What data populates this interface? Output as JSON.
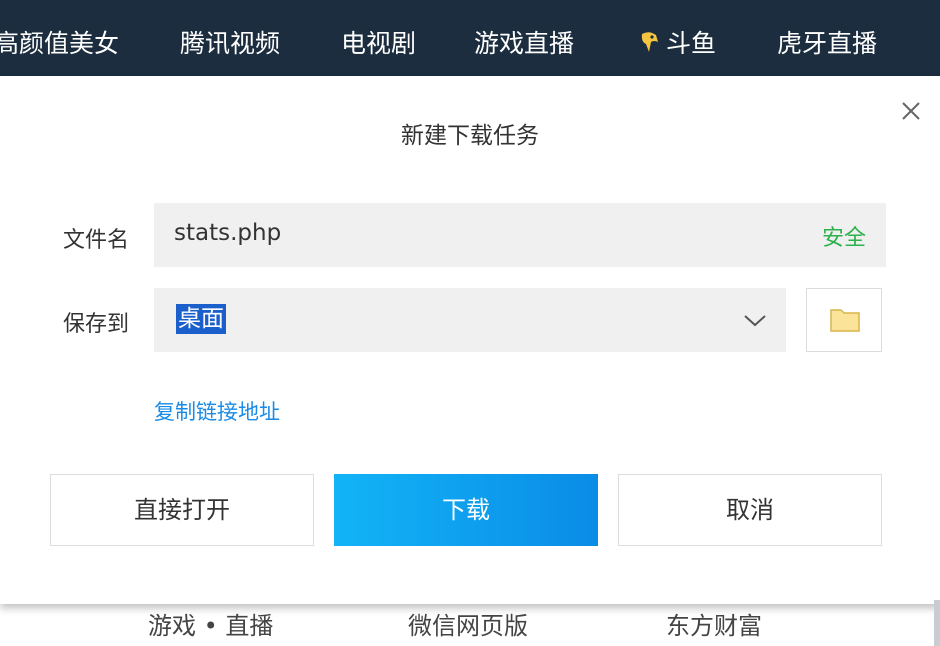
{
  "topnav": {
    "items": [
      {
        "label": "高颜值美女"
      },
      {
        "label": "腾讯视频"
      },
      {
        "label": "电视剧"
      },
      {
        "label": "游戏直播"
      },
      {
        "label": "斗鱼",
        "icon": "douyu-fish-icon"
      },
      {
        "label": "虎牙直播"
      }
    ]
  },
  "dialog": {
    "title": "新建下载任务",
    "close_icon": "close-icon",
    "filename_label": "文件名",
    "filename_value": "stats.php",
    "safe_tag": "安全",
    "saveto_label": "保存到",
    "saveto_value": "桌面",
    "dropdown_icon": "chevron-down-icon",
    "folder_icon": "folder-icon",
    "copy_link": "复制链接地址",
    "buttons": {
      "open": "直接打开",
      "download": "下载",
      "cancel": "取消"
    }
  },
  "bottom_links": [
    {
      "label": "游戏 • 直播"
    },
    {
      "label": "微信网页版"
    },
    {
      "label": "东方财富"
    }
  ],
  "colors": {
    "topnav_bg": "#1b2d3e",
    "safe_green": "#2bb24c",
    "link_blue": "#1a8be6",
    "download_gradient_start": "#12b4f7",
    "download_gradient_end": "#0a8ce6",
    "selection_blue": "#1a5fcb"
  }
}
